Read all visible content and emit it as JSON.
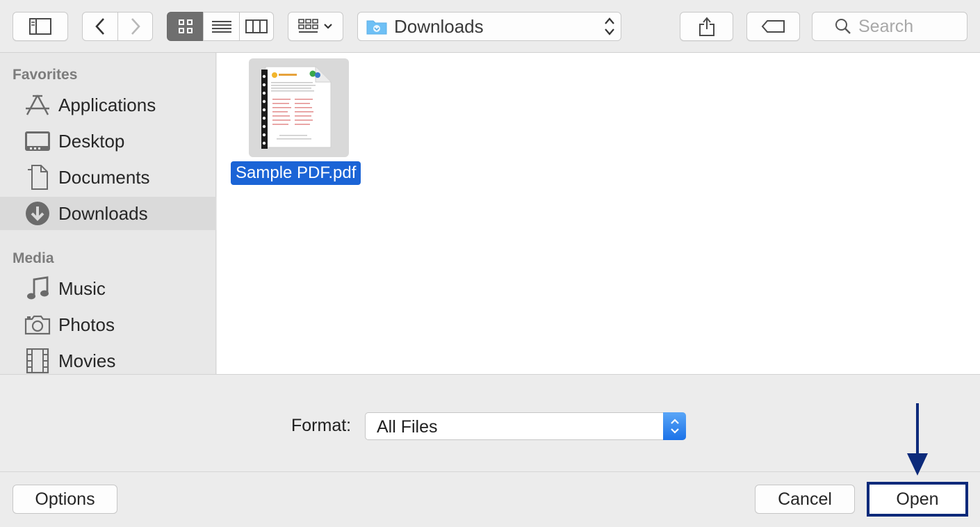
{
  "toolbar": {
    "path": {
      "label": "Downloads"
    },
    "search": {
      "placeholder": "Search"
    }
  },
  "sidebar": {
    "sections": [
      {
        "heading": "Favorites",
        "items": [
          {
            "label": "Applications",
            "icon": "applications-icon"
          },
          {
            "label": "Desktop",
            "icon": "desktop-icon"
          },
          {
            "label": "Documents",
            "icon": "documents-icon"
          },
          {
            "label": "Downloads",
            "icon": "downloads-icon",
            "selected": true
          }
        ]
      },
      {
        "heading": "Media",
        "items": [
          {
            "label": "Music",
            "icon": "music-icon"
          },
          {
            "label": "Photos",
            "icon": "camera-icon"
          },
          {
            "label": "Movies",
            "icon": "film-icon"
          }
        ]
      }
    ]
  },
  "files": [
    {
      "name": "Sample PDF.pdf",
      "selected": true
    }
  ],
  "format": {
    "label": "Format:",
    "value": "All Files"
  },
  "buttons": {
    "options": "Options",
    "cancel": "Cancel",
    "open": "Open"
  },
  "colors": {
    "selection": "#1b64d6",
    "highlight_box": "#0c2a7a"
  }
}
